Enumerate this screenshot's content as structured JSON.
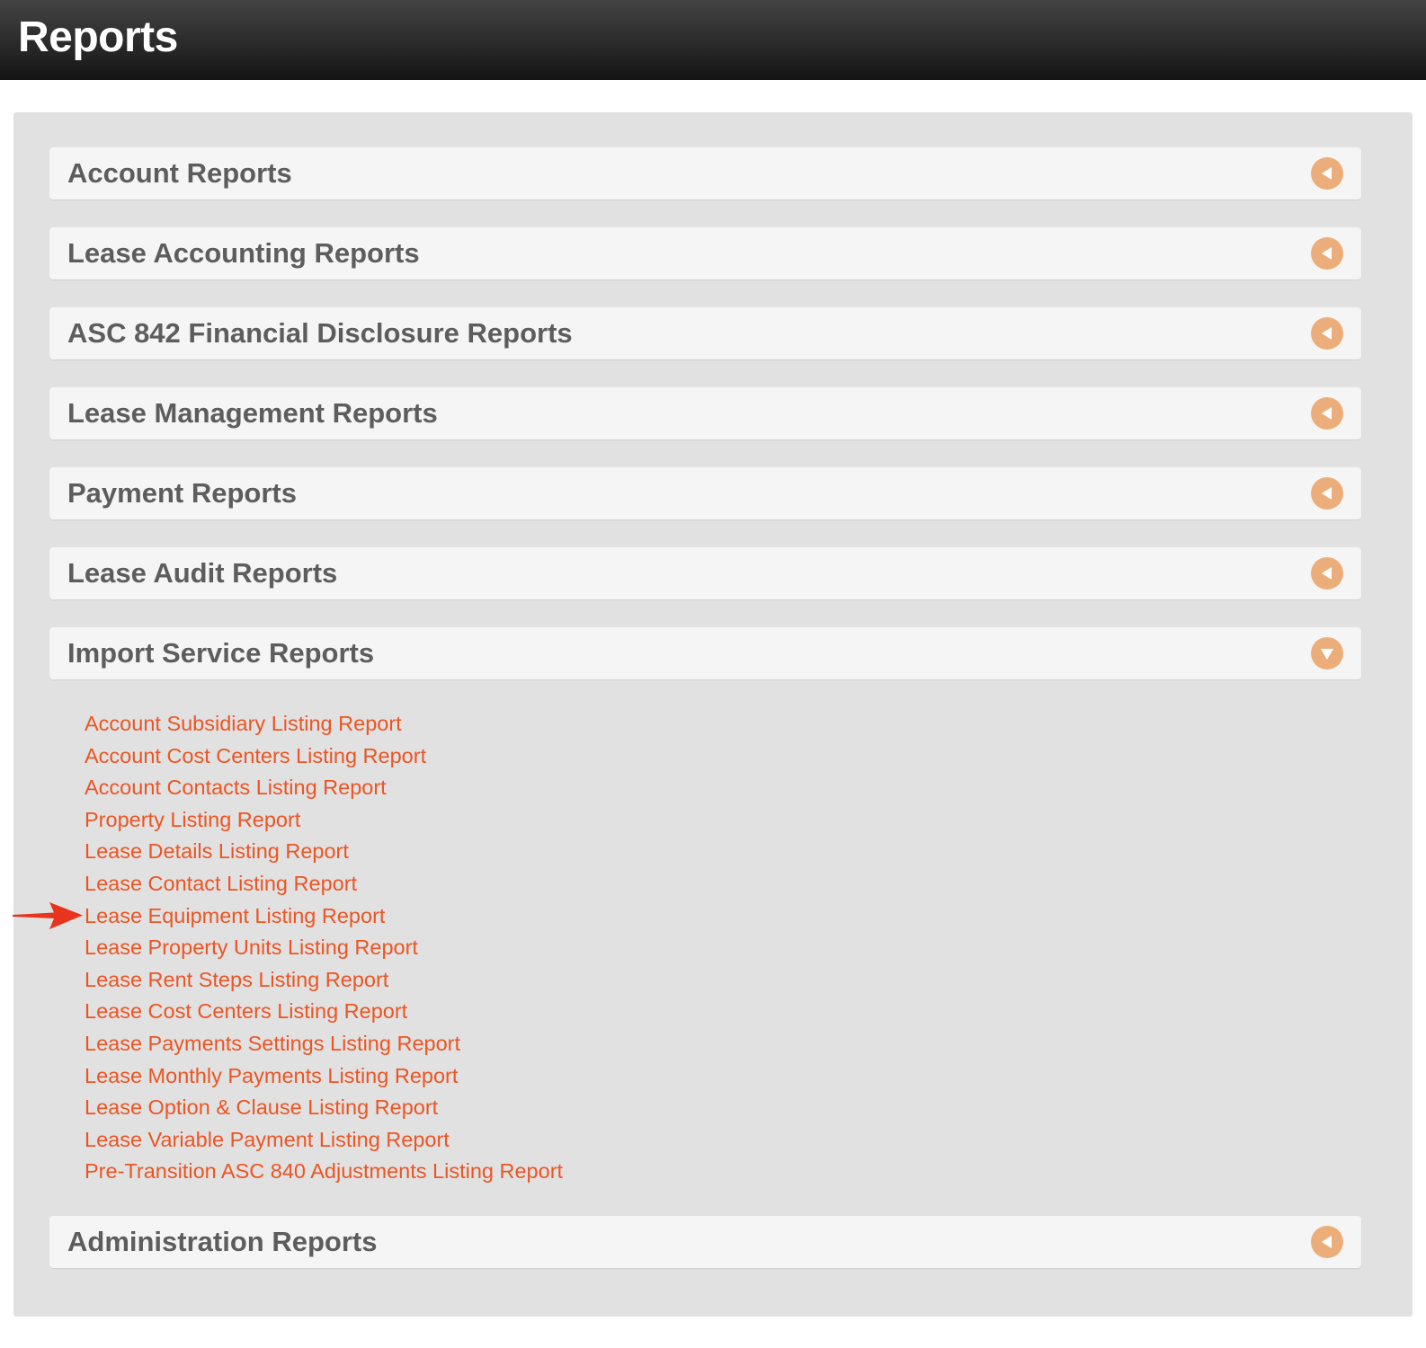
{
  "header": {
    "title": "Reports"
  },
  "sections": [
    {
      "title": "Account Reports",
      "expanded": false
    },
    {
      "title": "Lease Accounting Reports",
      "expanded": false
    },
    {
      "title": "ASC 842 Financial Disclosure Reports",
      "expanded": false
    },
    {
      "title": "Lease Management Reports",
      "expanded": false
    },
    {
      "title": "Payment Reports",
      "expanded": false
    },
    {
      "title": "Lease Audit Reports",
      "expanded": false
    },
    {
      "title": "Import Service Reports",
      "expanded": true
    },
    {
      "title": "Administration Reports",
      "expanded": false
    }
  ],
  "import_service_links": [
    "Account Subsidiary Listing Report",
    "Account Cost Centers Listing Report",
    "Account Contacts Listing Report",
    "Property Listing Report",
    "Lease Details Listing Report",
    "Lease Contact Listing Report",
    "Lease Equipment Listing Report",
    "Lease Property Units Listing Report",
    "Lease Rent Steps Listing Report",
    "Lease Cost Centers Listing Report",
    "Lease Payments Settings Listing Report",
    "Lease Monthly Payments Listing Report",
    "Lease Option & Clause Listing Report",
    "Lease Variable Payment Listing Report",
    "Pre-Transition ASC 840 Adjustments Listing Report"
  ],
  "icons": {
    "collapsed": "triangle-left-icon",
    "expanded": "triangle-down-icon",
    "annotation": "red-arrow-icon"
  },
  "colors": {
    "link": "#ec5523",
    "toggle": "#ebae7a",
    "annotation_arrow": "#e8341c"
  }
}
